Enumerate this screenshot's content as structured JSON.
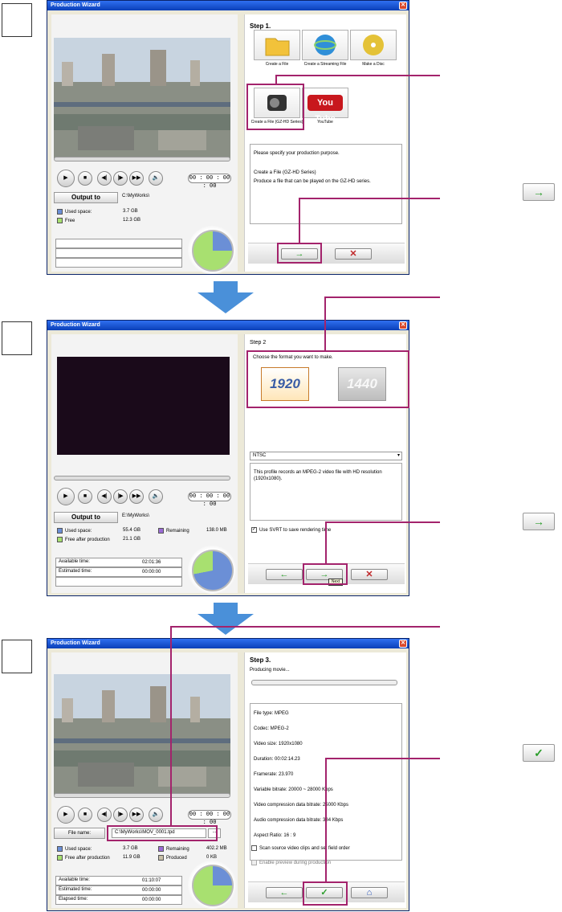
{
  "steps": [
    "1",
    "2",
    "3"
  ],
  "window_title": "Production Wizard",
  "close_glyph": "✕",
  "colors": {
    "highlight": "#a3236c",
    "arrow_blue": "#4a90d9"
  },
  "common": {
    "play": "▶",
    "stop": "■",
    "prev": "◀|",
    "next_frame": "|▶",
    "ff": "▶▶",
    "audio": "🔈",
    "time": "00 : 00 : 00 : 00",
    "next_arrow": "→",
    "back_arrow": "←",
    "cancel": "✕",
    "check": "✓",
    "home": "⌂"
  },
  "s1": {
    "output_label": "Output to",
    "output_path": "C:\\MyWorks\\",
    "used_label": "Used space:",
    "used_value": "3.7 GB",
    "free_label": "Free",
    "free_value": "12.3 GB",
    "step_title": "Step 1.",
    "icons": [
      "Create a File",
      "Create a Streaming File",
      "Make a Disc",
      "Create a File (GZ-HD Series)",
      "YouTube"
    ],
    "youtube_logo": "You Tube",
    "desc_line1": "Please specify your production purpose.",
    "desc_line2": "Create a File (GZ-HD Series)",
    "desc_line3": "Produce a file that can be played on the GZ-HD series."
  },
  "s2": {
    "output_label": "Output to",
    "output_path": "E:\\MyWorks\\",
    "used_label": "Used space:",
    "used_value": "55.4 GB",
    "remaining_label": "Remaining",
    "remaining_value": "138.0 MB",
    "free_after_label": "Free after production",
    "free_after_value": "21.1 GB",
    "available_label": "Available time:",
    "available_value": "02:01:36",
    "estimated_label": "Estimated time:",
    "estimated_value": "00:00:00",
    "step_title": "Step 2",
    "choose_text": "Choose the format you want to make.",
    "fmt1": "1920",
    "fmt2": "1440",
    "select_value": "NTSC",
    "desc": "This profile records an MPEG-2 video file with HD resolution (1920x1080).",
    "svrt_label": "Use SVRT to save rendering time",
    "tooltip": "Next"
  },
  "s3": {
    "file_label": "File name:",
    "file_path": "C:\\MyWorks\\MOV_0001.tpd",
    "browse": "...",
    "used_label": "Used space:",
    "used_value": "3.7 GB",
    "remaining_label": "Remaining",
    "remaining_value": "402.2 MB",
    "free_after_label": "Free after production",
    "free_after_value": "11.9 GB",
    "produced_label": "Produced",
    "produced_value": "0 KB",
    "available_label": "Available time:",
    "available_value": "01:10:07",
    "estimated_label": "Estimated time:",
    "estimated_value": "00:00:00",
    "elapsed_label": "Elapsed time:",
    "elapsed_value": "00:00:00",
    "step_title": "Step 3.",
    "producing": "Producing movie...",
    "progress": 0,
    "info": [
      "File type: MPEG",
      "Codec: MPEG-2",
      "Video size: 1920x1080",
      "Duration: 00:02:14.23",
      "Framerate: 23.970",
      "Variable bitrate: 20000 ~ 28000 Kbps",
      "Video compression data bitrate: 25000 Kbps",
      "Audio compression data bitrate: 384 Kbps",
      "Aspect Ratio: 16 : 9"
    ],
    "scan_label": "Scan source video clips and set field order",
    "preview_label": "Enable preview during production"
  }
}
